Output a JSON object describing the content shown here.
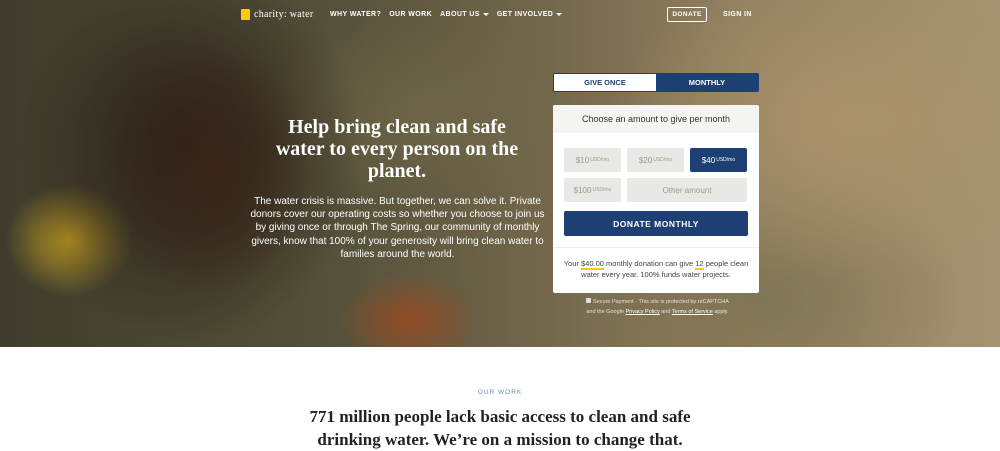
{
  "nav": {
    "logo_text": "charity: water",
    "links": [
      {
        "label": "WHY WATER?",
        "caret": false
      },
      {
        "label": "OUR WORK",
        "caret": false
      },
      {
        "label": "ABOUT US",
        "caret": true
      },
      {
        "label": "GET INVOLVED",
        "caret": true
      }
    ],
    "donate_label": "DONATE",
    "signin_label": "SIGN IN"
  },
  "hero": {
    "title": "Help bring clean and safe water to every person on the planet.",
    "description": "The water crisis is massive. But together, we can solve it. Private donors cover our operating costs so whether you choose to join us by giving once or through The Spring, our community of monthly givers, know that 100% of your generosity will bring clean water to families around the world."
  },
  "donation": {
    "tabs": {
      "once": "GIVE ONCE",
      "monthly": "MONTHLY"
    },
    "header": "Choose an amount to give per month",
    "amounts": [
      {
        "value": "$10",
        "unit": "USD/mo",
        "selected": false
      },
      {
        "value": "$20",
        "unit": "USD/mo",
        "selected": false
      },
      {
        "value": "$40",
        "unit": "USD/mo",
        "selected": true
      },
      {
        "value": "$100",
        "unit": "USD/mo",
        "selected": false
      }
    ],
    "other_placeholder": "Other amount",
    "button_label": "DONATE MONTHLY",
    "impact": {
      "prefix": "Your",
      "amount": "$40.00",
      "middle": "monthly donation can give",
      "people": "12",
      "suffix": "people clean water every year. 100% funds water projects."
    },
    "secure": {
      "line1": "Secure Payment · This site is protected by reCAPTCHA",
      "line2_prefix": "and the Google",
      "privacy": "Privacy Policy",
      "and": "and",
      "terms": "Terms of Service",
      "apply": "apply."
    }
  },
  "our_work": {
    "eyebrow": "OUR WORK",
    "headline": "771 million people lack basic access to clean and safe drinking water. We’re on a mission to change that."
  },
  "colors": {
    "brand_navy": "#1e3f73",
    "brand_yellow": "#ffc907"
  }
}
